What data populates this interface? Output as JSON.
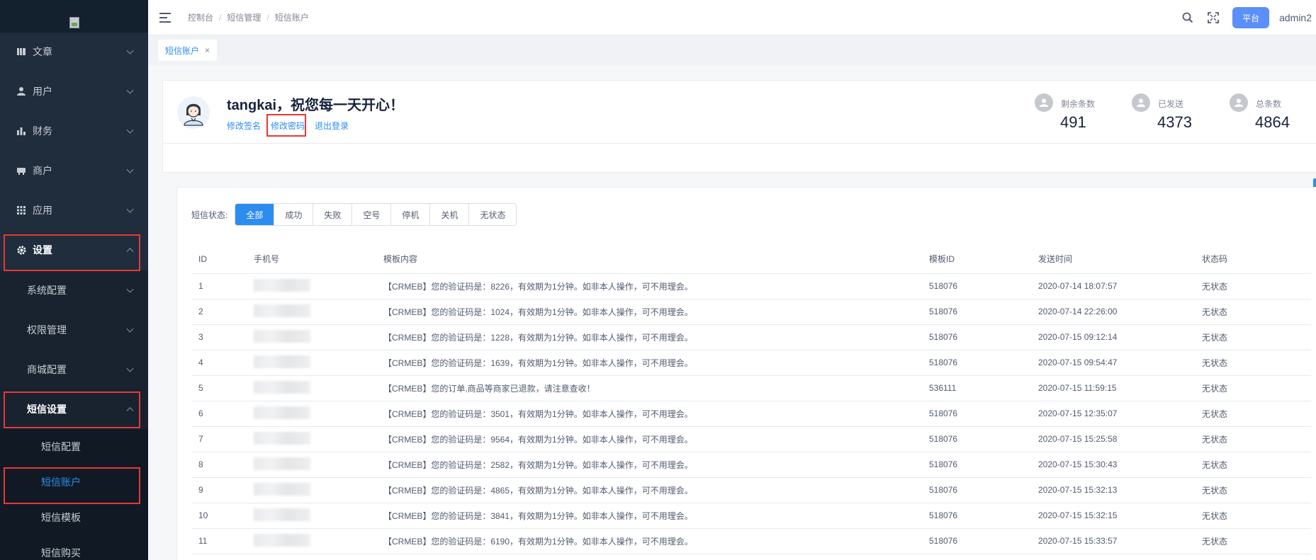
{
  "header": {
    "breadcrumb": [
      "控制台",
      "短信管理",
      "短信账户"
    ],
    "platform_label": "平台",
    "user_name": "admin2"
  },
  "tabs": [
    {
      "label": "短信账户",
      "close": "×"
    }
  ],
  "sidebar": {
    "items": [
      {
        "label": "文章",
        "icon": "book-icon"
      },
      {
        "label": "用户",
        "icon": "user-icon"
      },
      {
        "label": "财务",
        "icon": "bar-chart-icon"
      },
      {
        "label": "商户",
        "icon": "store-icon"
      },
      {
        "label": "应用",
        "icon": "grid-icon"
      },
      {
        "label": "设置",
        "icon": "gear-icon"
      }
    ],
    "settings_children": [
      "系统配置",
      "权限管理",
      "商城配置",
      "短信设置"
    ],
    "sms_children": [
      "短信配置",
      "短信账户",
      "短信模板",
      "短信购买"
    ]
  },
  "profile": {
    "greeting": "tangkai，祝您每一天开心！",
    "links": [
      "修改签名",
      "修改密码",
      "退出登录"
    ],
    "stats": [
      {
        "label": "剩余条数",
        "value": "491"
      },
      {
        "label": "已发送",
        "value": "4373"
      },
      {
        "label": "总条数",
        "value": "4864"
      }
    ]
  },
  "filter": {
    "label": "短信状态:",
    "options": [
      "全部",
      "成功",
      "失败",
      "空号",
      "停机",
      "关机",
      "无状态"
    ],
    "active": "全部"
  },
  "table": {
    "columns": [
      "ID",
      "手机号",
      "模板内容",
      "模板ID",
      "发送时间",
      "状态码"
    ],
    "rows": [
      {
        "id": "1",
        "content": "【CRMEB】您的验证码是：8226，有效期为1分钟。如非本人操作，可不用理会。",
        "template_id": "518076",
        "time": "2020-07-14 18:07:57",
        "status": "无状态"
      },
      {
        "id": "2",
        "content": "【CRMEB】您的验证码是：1024，有效期为1分钟。如非本人操作，可不用理会。",
        "template_id": "518076",
        "time": "2020-07-14 22:26:00",
        "status": "无状态"
      },
      {
        "id": "3",
        "content": "【CRMEB】您的验证码是：1228，有效期为1分钟。如非本人操作，可不用理会。",
        "template_id": "518076",
        "time": "2020-07-15 09:12:14",
        "status": "无状态"
      },
      {
        "id": "4",
        "content": "【CRMEB】您的验证码是：1639，有效期为1分钟。如非本人操作，可不用理会。",
        "template_id": "518076",
        "time": "2020-07-15 09:54:47",
        "status": "无状态"
      },
      {
        "id": "5",
        "content": "【CRMEB】您的订单,商品等商家已退款，请注意查收！",
        "template_id": "536111",
        "time": "2020-07-15 11:59:15",
        "status": "无状态"
      },
      {
        "id": "6",
        "content": "【CRMEB】您的验证码是：3501，有效期为1分钟。如非本人操作，可不用理会。",
        "template_id": "518076",
        "time": "2020-07-15 12:35:07",
        "status": "无状态"
      },
      {
        "id": "7",
        "content": "【CRMEB】您的验证码是：9564，有效期为1分钟。如非本人操作，可不用理会。",
        "template_id": "518076",
        "time": "2020-07-15 15:25:58",
        "status": "无状态"
      },
      {
        "id": "8",
        "content": "【CRMEB】您的验证码是：2582，有效期为1分钟。如非本人操作，可不用理会。",
        "template_id": "518076",
        "time": "2020-07-15 15:30:43",
        "status": "无状态"
      },
      {
        "id": "9",
        "content": "【CRMEB】您的验证码是：4865，有效期为1分钟。如非本人操作，可不用理会。",
        "template_id": "518076",
        "time": "2020-07-15 15:32:13",
        "status": "无状态"
      },
      {
        "id": "10",
        "content": "【CRMEB】您的验证码是：3841，有效期为1分钟。如非本人操作，可不用理会。",
        "template_id": "518076",
        "time": "2020-07-15 15:32:15",
        "status": "无状态"
      },
      {
        "id": "11",
        "content": "【CRMEB】您的验证码是：6190，有效期为1分钟。如非本人操作，可不用理会。",
        "template_id": "518076",
        "time": "2020-07-15 15:33:57",
        "status": "无状态"
      }
    ]
  },
  "colors": {
    "accent": "#2d8cf0",
    "sidebar": "#1f2d3d",
    "highlight": "#e53935",
    "platform": "#5b8ff9"
  }
}
